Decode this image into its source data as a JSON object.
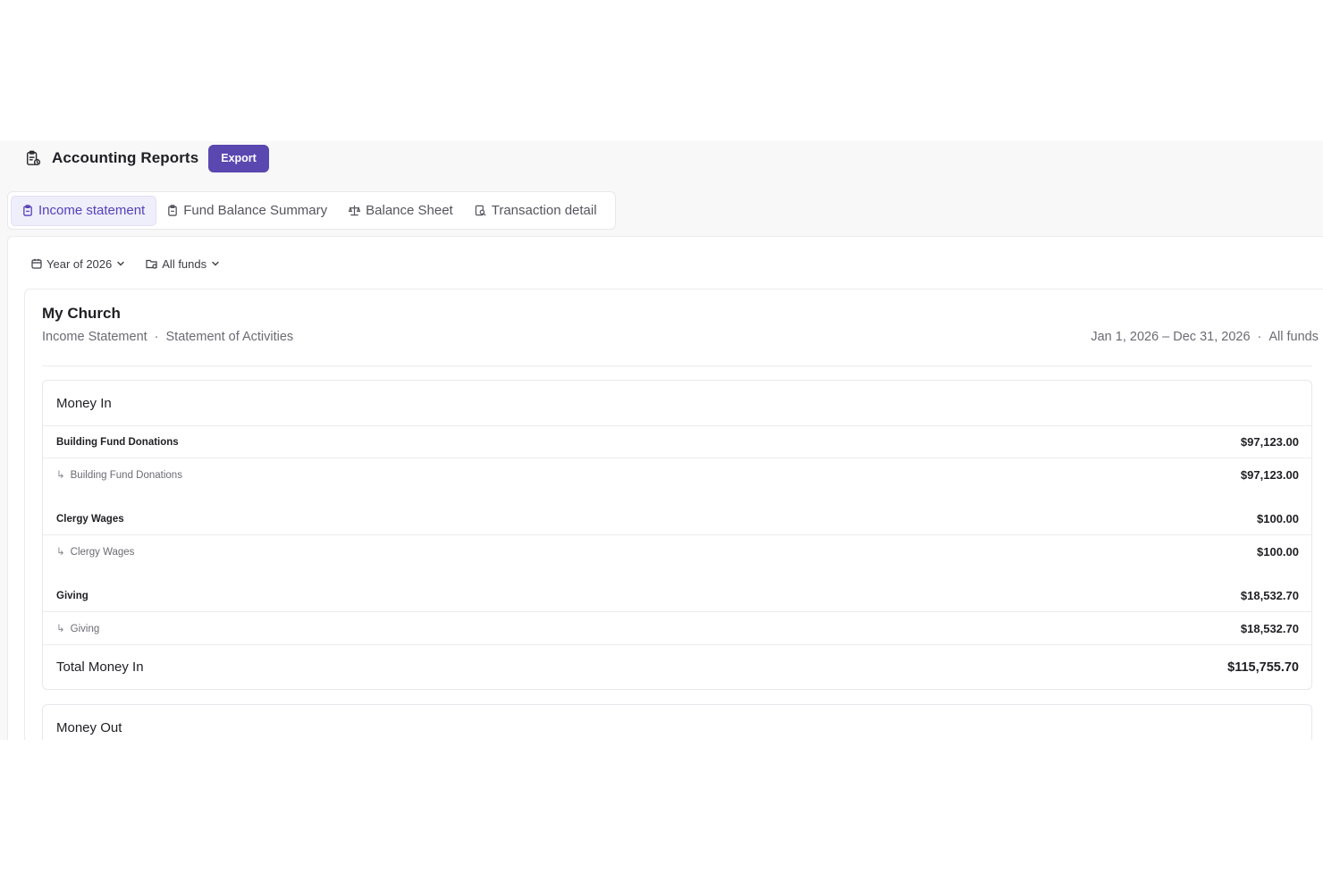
{
  "header": {
    "title": "Accounting Reports",
    "export_label": "Export",
    "icon": "report-icon"
  },
  "tabs": [
    {
      "label": "Income statement",
      "icon": "clipboard-icon",
      "active": true
    },
    {
      "label": "Fund Balance Summary",
      "icon": "clipboard-icon",
      "active": false
    },
    {
      "label": "Balance Sheet",
      "icon": "scale-icon",
      "active": false
    },
    {
      "label": "Transaction detail",
      "icon": "search-document-icon",
      "active": false
    }
  ],
  "filters": {
    "period": "Year of 2026",
    "funds": "All funds"
  },
  "report": {
    "org_name": "My Church",
    "subtitle_a": "Income Statement",
    "subtitle_sep": "·",
    "subtitle_b": "Statement of Activities",
    "date_range": "Jan 1, 2026 – Dec 31, 2026",
    "meta_sep": "·",
    "funds": "All funds"
  },
  "money_in": {
    "title": "Money In",
    "groups": [
      {
        "name": "Building Fund Donations",
        "amount": "$97,123.00",
        "child_name": "Building Fund Donations",
        "child_amount": "$97,123.00"
      },
      {
        "name": "Clergy Wages",
        "amount": "$100.00",
        "child_name": "Clergy Wages",
        "child_amount": "$100.00"
      },
      {
        "name": "Giving",
        "amount": "$18,532.70",
        "child_name": "Giving",
        "child_amount": "$18,532.70"
      }
    ],
    "total_label": "Total Money In",
    "total_amount": "$115,755.70"
  },
  "money_out": {
    "title": "Money Out"
  },
  "colors": {
    "accent": "#5b47b0",
    "tab_active_bg": "#efeefb",
    "tab_active_text": "#5640b8"
  }
}
